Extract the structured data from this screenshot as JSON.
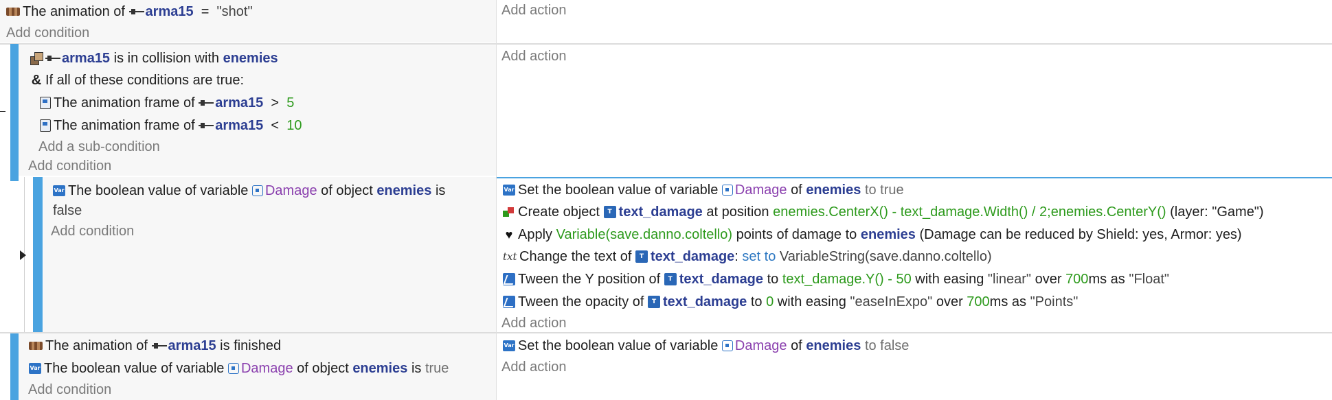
{
  "icons": {
    "animation": "film-strip-icon",
    "object": "gun-icon",
    "collision": "collision-icon",
    "and": "ampersand-icon",
    "frame": "animation-frame-icon",
    "variable": "variable-icon",
    "text_object": "text-object-icon",
    "create": "create-object-icon",
    "damage": "heart-icon",
    "text": "txt-icon",
    "tween": "tween-icon"
  },
  "colors": {
    "accent_bar": "#4aa3e0",
    "object": "#2c3e92",
    "variable": "#8a3fae",
    "number": "#2d9a1c"
  },
  "labels": {
    "add_action": "Add action",
    "add_condition": "Add condition",
    "add_subcondition": "Add a sub-condition"
  },
  "e1": {
    "c1": {
      "pre": "The animation of",
      "obj": "arma15",
      "op": "=",
      "val": "\"shot\""
    }
  },
  "e2": {
    "c1": {
      "obj": "arma15",
      "mid": "is in collision with",
      "obj2": "enemies"
    },
    "c2": {
      "text": "If all of these conditions are true:"
    },
    "sub1": {
      "pre": "The animation frame of",
      "obj": "arma15",
      "op": ">",
      "val": "5"
    },
    "sub2": {
      "pre": "The animation frame of",
      "obj": "arma15",
      "op": "<",
      "val": "10"
    }
  },
  "e3": {
    "c1": {
      "pre": "The boolean value of variable",
      "var": "Damage",
      "mid": "of object",
      "obj": "enemies",
      "end": "is",
      "val": "false"
    },
    "a1": {
      "pre": "Set the boolean value of variable",
      "var": "Damage",
      "mid": "of",
      "obj": "enemies",
      "end": "to true"
    },
    "a2": {
      "pre": "Create object",
      "obj": "text_damage",
      "mid": "at position",
      "expr": "enemies.CenterX() - text_damage.Width() / 2;enemies.CenterY()",
      "end": "(layer: \"Game\")"
    },
    "a3": {
      "pre": "Apply",
      "expr": "Variable(save.danno.coltello)",
      "mid": "points of damage to",
      "obj": "enemies",
      "end": "(Damage can be reduced by Shield: yes, Armor: yes)"
    },
    "a4": {
      "pre": "Change the text of",
      "obj": "text_damage",
      "colon": ":",
      "op": "set to",
      "val": "VariableString(save.danno.coltello)"
    },
    "a5": {
      "pre": "Tween the Y position of",
      "obj": "text_damage",
      "mid": "to",
      "expr": "text_damage.Y() - 50",
      "mid2": "with easing",
      "ease": "\"linear\"",
      "mid3": "over",
      "dur": "700",
      "unit": "ms as",
      "id": "\"Float\""
    },
    "a6": {
      "pre": "Tween the opacity of",
      "obj": "text_damage",
      "mid": "to",
      "val": "0",
      "mid2": "with easing",
      "ease": "\"easeInExpo\"",
      "mid3": "over",
      "dur": "700",
      "unit": "ms as",
      "id": "\"Points\""
    }
  },
  "e4": {
    "c1": {
      "pre": "The animation of",
      "obj": "arma15",
      "end": "is finished"
    },
    "c2": {
      "pre": "The boolean value of variable",
      "var": "Damage",
      "mid": "of object",
      "obj": "enemies",
      "end": "is",
      "val": "true"
    },
    "a1": {
      "pre": "Set the boolean value of variable",
      "var": "Damage",
      "mid": "of",
      "obj": "enemies",
      "end": "to false"
    }
  }
}
